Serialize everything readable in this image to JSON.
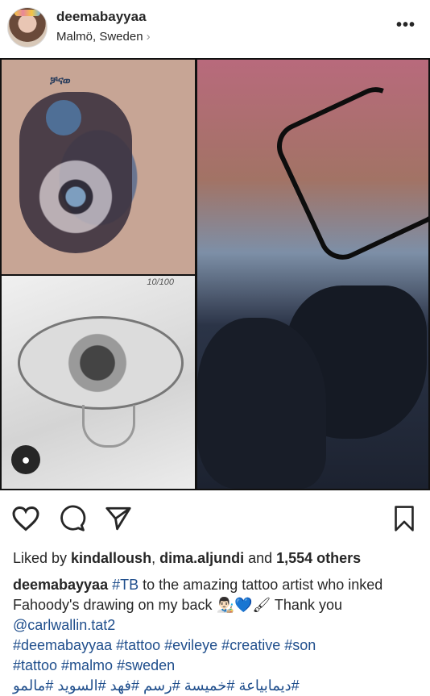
{
  "header": {
    "username": "deemabayyaa",
    "location": "Malmö, Sweden",
    "location_chevron": "›",
    "more": "•••"
  },
  "photo": {
    "sketch_number": "10/100",
    "tag_icon": "person-icon"
  },
  "actions": {
    "like_icon": "heart-icon",
    "comment_icon": "comment-icon",
    "share_icon": "paper-plane-icon",
    "save_icon": "bookmark-icon"
  },
  "likes": {
    "prefix": "Liked by ",
    "user1": "kindalloush",
    "sep": ", ",
    "user2": "dima.aljundi",
    "and": " and ",
    "others": "1,554 others"
  },
  "caption": {
    "author": "deemabayyaa",
    "hashtag_tb": "#TB",
    "text1": " to the amazing tattoo artist who inked Fahoody's drawing on my back ",
    "emojis": "👨🏻‍🎨💙🖌",
    "text2": " Thank you ",
    "mention": "@carlwallin.tat2",
    "hashtags_line1": "#deemabayyaa #tattoo #evileye #creative #son",
    "hashtags_line2": "#tattoo #malmo #sweden",
    "hashtags_arabic": "#ديمابياعة #خميسة #رسم #فهد #السويد #مالمو"
  }
}
